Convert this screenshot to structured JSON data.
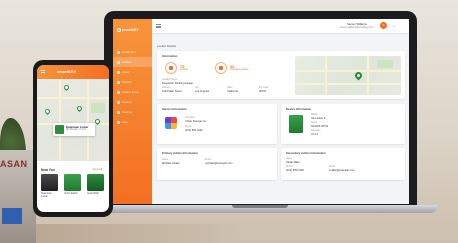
{
  "scene": {
    "background_sign_text": "ASAN"
  },
  "laptop": {
    "brand": {
      "name": "smartKEY"
    },
    "nav": [
      "Dashboard",
      "Lockers",
      "Users",
      "Rentals",
      "Access Rules",
      "Reports",
      "Settings",
      "Help"
    ],
    "active_nav_index": 1,
    "topbar": {
      "user_name": "Steven Williams",
      "user_email": "steven.williams@smartkey.com",
      "avatar_initial": "S"
    },
    "breadcrumb": "Locker Details",
    "overview": {
      "title": "Information",
      "stats": [
        {
          "value": "75",
          "label": "Lockers"
        },
        {
          "value": "20",
          "label": "Occupied Lockers"
        }
      ],
      "fields": [
        {
          "key": "Location Name",
          "value": "Downtown Parking Garage"
        },
        {
          "key": "Address",
          "value": "1234 Main Street"
        },
        {
          "key": "City",
          "value": "Los Angeles"
        },
        {
          "key": "State",
          "value": "California"
        },
        {
          "key": "Zip Code",
          "value": "90017"
        }
      ]
    },
    "owner": {
      "title": "Owner Information",
      "fields": [
        {
          "key": "Company",
          "value": "Urban Storage Co."
        },
        {
          "key": "Phone",
          "value": "(213) 555-0142"
        }
      ]
    },
    "device": {
      "title": "Device Information",
      "fields": [
        {
          "key": "Model",
          "value": "SK-Locker 3"
        },
        {
          "key": "Serial",
          "value": "SK2024-00731"
        },
        {
          "key": "Firmware",
          "value": "v3.2.1"
        }
      ]
    },
    "primary": {
      "title": "Primary Admin Information",
      "fields": [
        {
          "key": "Name",
          "value": "Michael Jordan"
        },
        {
          "key": "Email",
          "value": "mjordan@example.com"
        }
      ]
    },
    "secondary": {
      "title": "Secondary Admin Information",
      "fields": [
        {
          "key": "Name",
          "value": "Sarah Miller"
        },
        {
          "key": "Phone",
          "value": "(213) 555-0199"
        },
        {
          "key": "Email",
          "value": "smiller@example.com"
        }
      ]
    }
  },
  "phone": {
    "brand": {
      "name": "smartKEY"
    },
    "popup": {
      "title": "Downtown Locker",
      "subtitle": "SK Rentals · 0.4 mi"
    },
    "section_title": "Near You",
    "view_all": "View All",
    "cards": [
      {
        "caption": "Downtown Locker"
      },
      {
        "caption": "Union Station"
      },
      {
        "caption": "Grand Park"
      }
    ]
  },
  "colors": {
    "accent": "#f36f21",
    "accent_light": "#f7943a",
    "locker_green": "#2d8d3c",
    "pin_green": "#1f8f3a"
  },
  "icons": [
    "hamburger-menu-icon",
    "chevron-down-icon",
    "map-pin-icon",
    "locker-icon"
  ]
}
